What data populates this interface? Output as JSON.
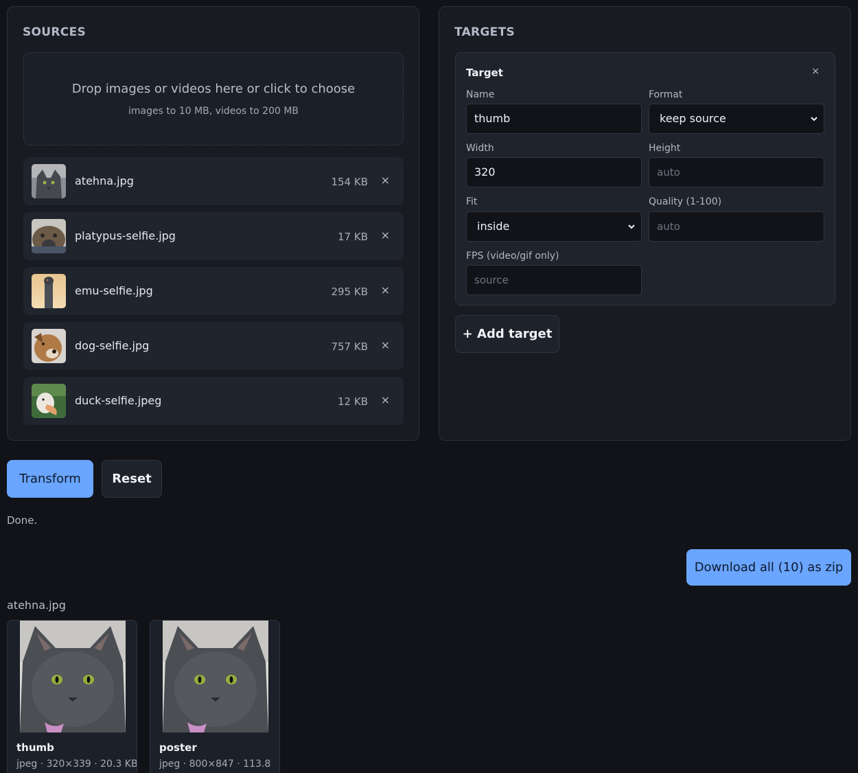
{
  "sources": {
    "title": "SOURCES",
    "dropzone": {
      "main": "Drop images or videos here or click to choose",
      "sub": "images to 10 MB, videos to 200 MB"
    },
    "files": [
      {
        "name": "atehna.jpg",
        "size": "154 KB",
        "remove": "×"
      },
      {
        "name": "platypus-selfie.jpg",
        "size": "17 KB",
        "remove": "×"
      },
      {
        "name": "emu-selfie.jpg",
        "size": "295 KB",
        "remove": "×"
      },
      {
        "name": "dog-selfie.jpg",
        "size": "757 KB",
        "remove": "×"
      },
      {
        "name": "duck-selfie.jpeg",
        "size": "12 KB",
        "remove": "×"
      }
    ]
  },
  "targets": {
    "title": "TARGETS",
    "card": {
      "title": "Target",
      "close": "×",
      "name_label": "Name",
      "name_value": "thumb",
      "format_label": "Format",
      "format_value": "keep source",
      "width_label": "Width",
      "width_value": "320",
      "height_label": "Height",
      "height_placeholder": "auto",
      "fit_label": "Fit",
      "fit_value": "inside",
      "quality_label": "Quality (1-100)",
      "quality_placeholder": "auto",
      "fps_label": "FPS (video/gif only)",
      "fps_placeholder": "source"
    },
    "add_label": "+ Add target"
  },
  "actions": {
    "transform": "Transform",
    "reset": "Reset",
    "status": "Done.",
    "download": "Download all (10) as zip"
  },
  "results": {
    "group_title": "atehna.jpg",
    "items": [
      {
        "name": "thumb",
        "meta": "jpeg · 320×339 · 20.3 KB"
      },
      {
        "name": "poster",
        "meta": "jpeg · 800×847 · 113.8"
      }
    ]
  },
  "colors": {
    "background": "#111318",
    "panel": "#181b22",
    "accent": "#6aa5ff"
  }
}
